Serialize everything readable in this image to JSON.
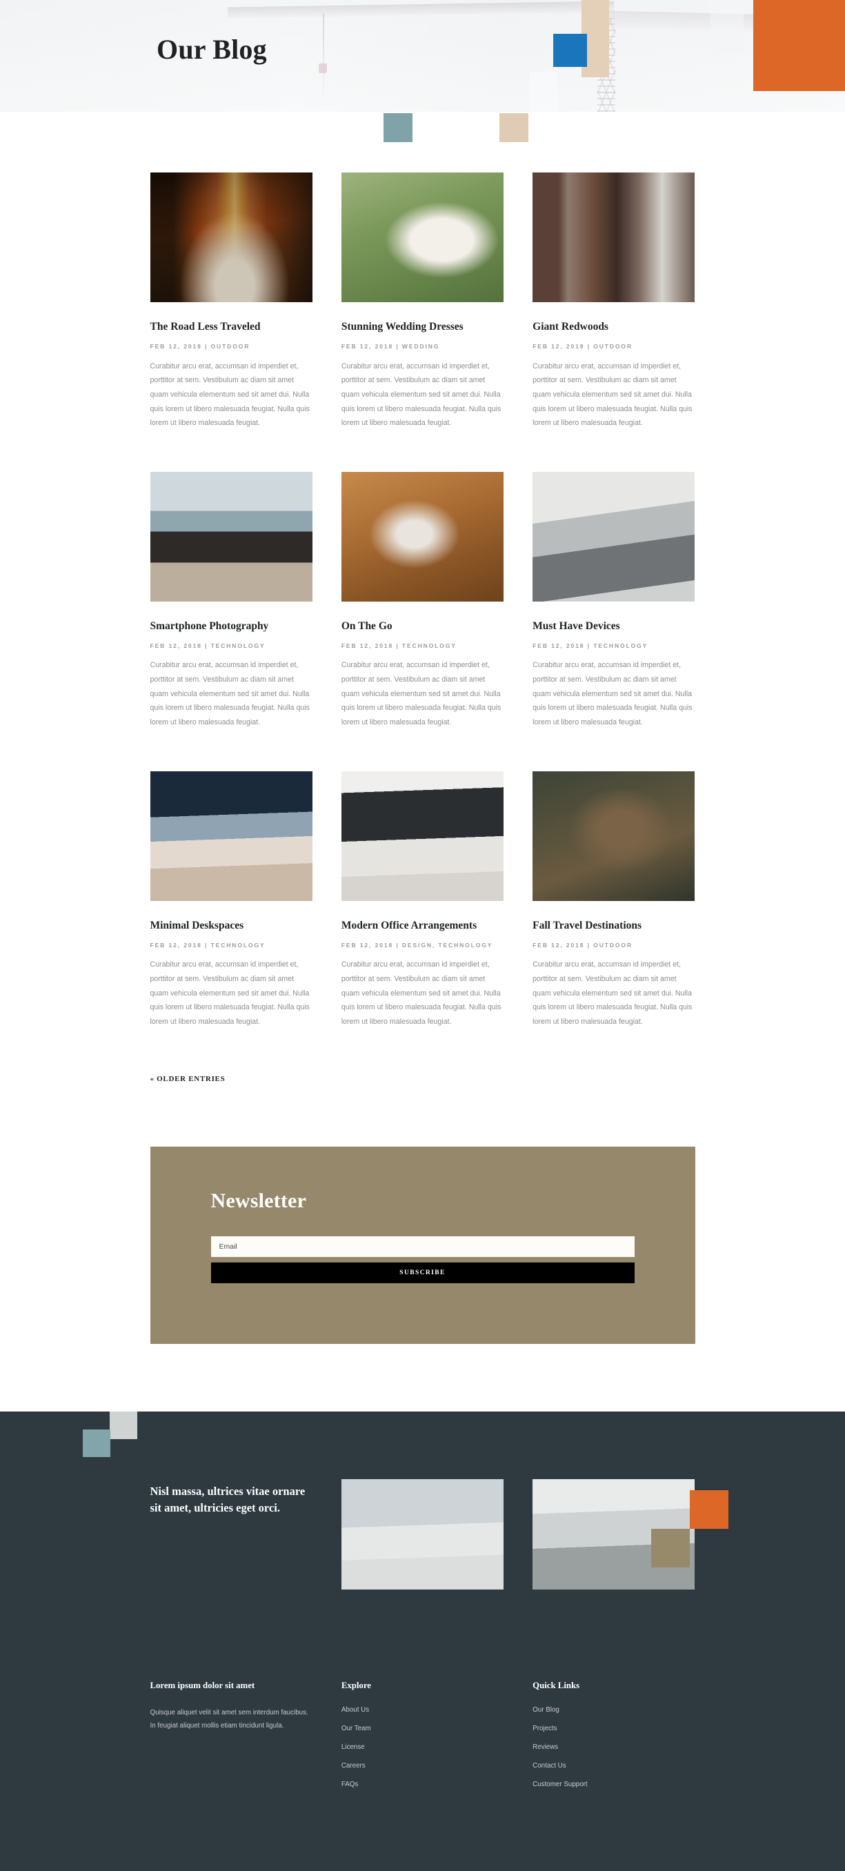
{
  "hero": {
    "title": "Our Blog",
    "colors": {
      "orange": "#dc6727",
      "blue": "#1b75bb",
      "tan": "#e4cfb9",
      "teal": "#7fa3a9",
      "background": "#e1e5e8"
    }
  },
  "blog": {
    "posts": [
      {
        "title": "The Road Less Traveled",
        "meta": "FEB 12, 2018  |  OUTDOOR",
        "excerpt": "Curabitur arcu erat, accumsan id imperdiet et, porttitor at sem. Vestibulum ac diam sit amet quam vehicula elementum sed sit amet dui. Nulla quis lorem ut libero malesuada feugiat. Nulla quis lorem ut libero malesuada feugiat.",
        "image": "forest-road-autumn"
      },
      {
        "title": "Stunning Wedding Dresses",
        "meta": "FEB 12, 2018  |  WEDDING",
        "excerpt": "Curabitur arcu erat, accumsan id imperdiet et, porttitor at sem. Vestibulum ac diam sit amet quam vehicula elementum sed sit amet dui. Nulla quis lorem ut libero malesuada feugiat. Nulla quis lorem ut libero malesuada feugiat.",
        "image": "bride-in-garden"
      },
      {
        "title": "Giant Redwoods",
        "meta": "FEB 12, 2018  |  OUTDOOR",
        "excerpt": "Curabitur arcu erat, accumsan id imperdiet et, porttitor at sem. Vestibulum ac diam sit amet quam vehicula elementum sed sit amet dui. Nulla quis lorem ut libero malesuada feugiat. Nulla quis lorem ut libero malesuada feugiat.",
        "image": "redwood-trees"
      },
      {
        "title": "Smartphone Photography",
        "meta": "FEB 12, 2018  |  TECHNOLOGY",
        "excerpt": "Curabitur arcu erat, accumsan id imperdiet et, porttitor at sem. Vestibulum ac diam sit amet quam vehicula elementum sed sit amet dui. Nulla quis lorem ut libero malesuada feugiat. Nulla quis lorem ut libero malesuada feugiat.",
        "image": "hands-holding-phone-mountains"
      },
      {
        "title": "On The Go",
        "meta": "FEB 12, 2018  |  TECHNOLOGY",
        "excerpt": "Curabitur arcu erat, accumsan id imperdiet et, porttitor at sem. Vestibulum ac diam sit amet quam vehicula elementum sed sit amet dui. Nulla quis lorem ut libero malesuada feugiat. Nulla quis lorem ut libero malesuada feugiat.",
        "image": "phone-stylus-leather-case"
      },
      {
        "title": "Must Have Devices",
        "meta": "FEB 12, 2018  |  TECHNOLOGY",
        "excerpt": "Curabitur arcu erat, accumsan id imperdiet et, porttitor at sem. Vestibulum ac diam sit amet quam vehicula elementum sed sit amet dui. Nulla quis lorem ut libero malesuada feugiat. Nulla quis lorem ut libero malesuada feugiat.",
        "image": "laptop-keyboard-desk"
      },
      {
        "title": "Minimal Deskspaces",
        "meta": "FEB 12, 2018  |  TECHNOLOGY",
        "excerpt": "Curabitur arcu erat, accumsan id imperdiet et, porttitor at sem. Vestibulum ac diam sit amet quam vehicula elementum sed sit amet dui. Nulla quis lorem ut libero malesuada feugiat. Nulla quis lorem ut libero malesuada feugiat.",
        "image": "white-keyboard-desk"
      },
      {
        "title": "Modern Office Arrangements",
        "meta": "FEB 12, 2018  |  DESIGN, TECHNOLOGY",
        "excerpt": "Curabitur arcu erat, accumsan id imperdiet et, porttitor at sem. Vestibulum ac diam sit amet quam vehicula elementum sed sit amet dui. Nulla quis lorem ut libero malesuada feugiat. Nulla quis lorem ut libero malesuada feugiat.",
        "image": "monitor-lamp-office"
      },
      {
        "title": "Fall Travel Destinations",
        "meta": "FEB 12, 2018  |  OUTDOOR",
        "excerpt": "Curabitur arcu erat, accumsan id imperdiet et, porttitor at sem. Vestibulum ac diam sit amet quam vehicula elementum sed sit amet dui. Nulla quis lorem ut libero malesuada feugiat. Nulla quis lorem ut libero malesuada feugiat.",
        "image": "pinecones-forest-floor"
      }
    ],
    "older_entries_label": "« OLDER ENTRIES"
  },
  "newsletter": {
    "heading": "Newsletter",
    "email_placeholder": "Email",
    "email_value": "",
    "subscribe_label": "SUBSCRIBE",
    "background_color": "#96886a"
  },
  "footer": {
    "headline": "Nisl massa, ultrices vitae ornare sit amet, ultricies eget orci.",
    "images": [
      {
        "name": "construction-worker-with-clipboard"
      },
      {
        "name": "concrete-mixer-truck"
      }
    ],
    "about": {
      "title": "Lorem ipsum dolor sit amet",
      "text": "Quisque aliquet velit sit amet sem interdum faucibus. In feugiat aliquet mollis etiam tincidunt ligula."
    },
    "explore": {
      "title": "Explore",
      "links": [
        "About Us",
        "Our Team",
        "License",
        "Careers",
        "FAQs"
      ]
    },
    "quick_links": {
      "title": "Quick Links",
      "links": [
        "Our Blog",
        "Projects",
        "Reviews",
        "Contact Us",
        "Customer Support"
      ]
    },
    "colors": {
      "background": "#2f3a40",
      "orange": "#dc6727",
      "khaki": "#968a6a",
      "teal": "#81a5ab",
      "gray": "#cfd3d2"
    }
  }
}
